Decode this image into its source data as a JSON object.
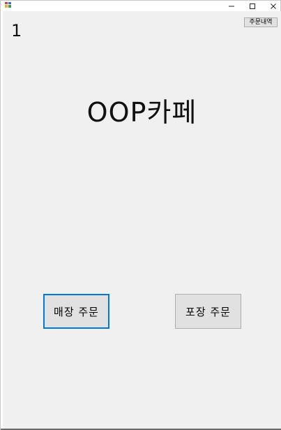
{
  "window": {
    "counter": "1",
    "history_button": "주문내역",
    "title": "OOP카페",
    "dine_in_button": "매장 주문",
    "takeout_button": "포장 주문"
  },
  "titlebar": {
    "minimize_icon": "minimize-icon",
    "maximize_icon": "maximize-icon",
    "close_icon": "close-icon"
  }
}
